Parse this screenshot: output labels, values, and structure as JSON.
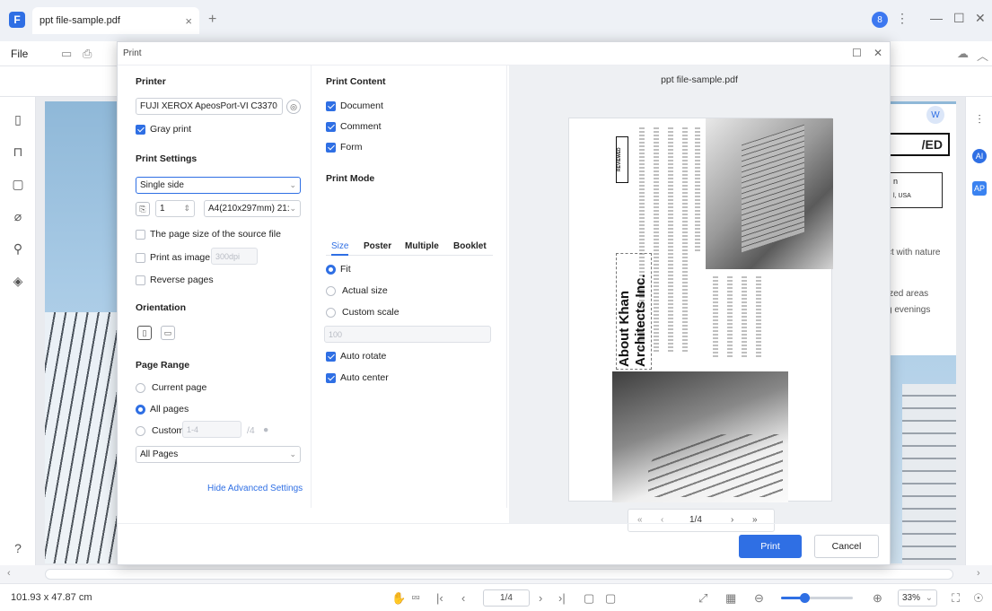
{
  "window": {
    "tab_title": "ppt file-sample.pdf",
    "tab_close": "×",
    "tab_add": "+",
    "avatar": "8",
    "menu_file": "File"
  },
  "background": {
    "card_reviewed": "/ED",
    "card_n": "n",
    "card_loc": "l, USA",
    "line1": "ct with nature",
    "line2": "ized areas",
    "line3": "g evenings",
    "ws_badge": "W"
  },
  "right_rail": {
    "ai_label": "AI",
    "ap_label": "AP"
  },
  "dialog": {
    "title": "Print",
    "printer_section": "Printer",
    "printer_name": "FUJI XEROX ApeosPort-VI C3370",
    "gray_print": "Gray print",
    "print_settings": "Print Settings",
    "side_mode": "Single side",
    "copies": "1",
    "paper_size": "A4(210x297mm) 21:",
    "page_size_source": "The page size of the source file",
    "print_as_image": "Print as image",
    "dpi_placeholder": "300dpi",
    "reverse_pages": "Reverse pages",
    "orientation": "Orientation",
    "page_range": "Page Range",
    "current_page": "Current page",
    "all_pages": "All pages",
    "custom": "Custom",
    "custom_range": "1-4",
    "custom_total": "/4",
    "page_subset": "All Pages",
    "hide_advanced": "Hide Advanced Settings",
    "print_content": "Print Content",
    "content_document": "Document",
    "content_comment": "Comment",
    "content_form": "Form",
    "print_mode": "Print Mode",
    "tabs": [
      "Size",
      "Poster",
      "Multiple",
      "Booklet"
    ],
    "fit": "Fit",
    "actual_size": "Actual size",
    "custom_scale": "Custom scale",
    "scale_value": "100",
    "auto_rotate": "Auto rotate",
    "auto_center": "Auto center",
    "print_button": "Print",
    "cancel_button": "Cancel"
  },
  "preview": {
    "filename": "ppt file-sample.pdf",
    "heading": "About Khan Architects Inc.",
    "reviewed": "REVIEWED",
    "page_indicator": "1/4",
    "first": "«",
    "prev": "‹",
    "next": "›",
    "last": "»"
  },
  "status": {
    "dimensions": "101.93 x 47.87 cm",
    "page_box": "1/4",
    "zoom": "33%",
    "zoom_level_fraction": 0.33
  }
}
